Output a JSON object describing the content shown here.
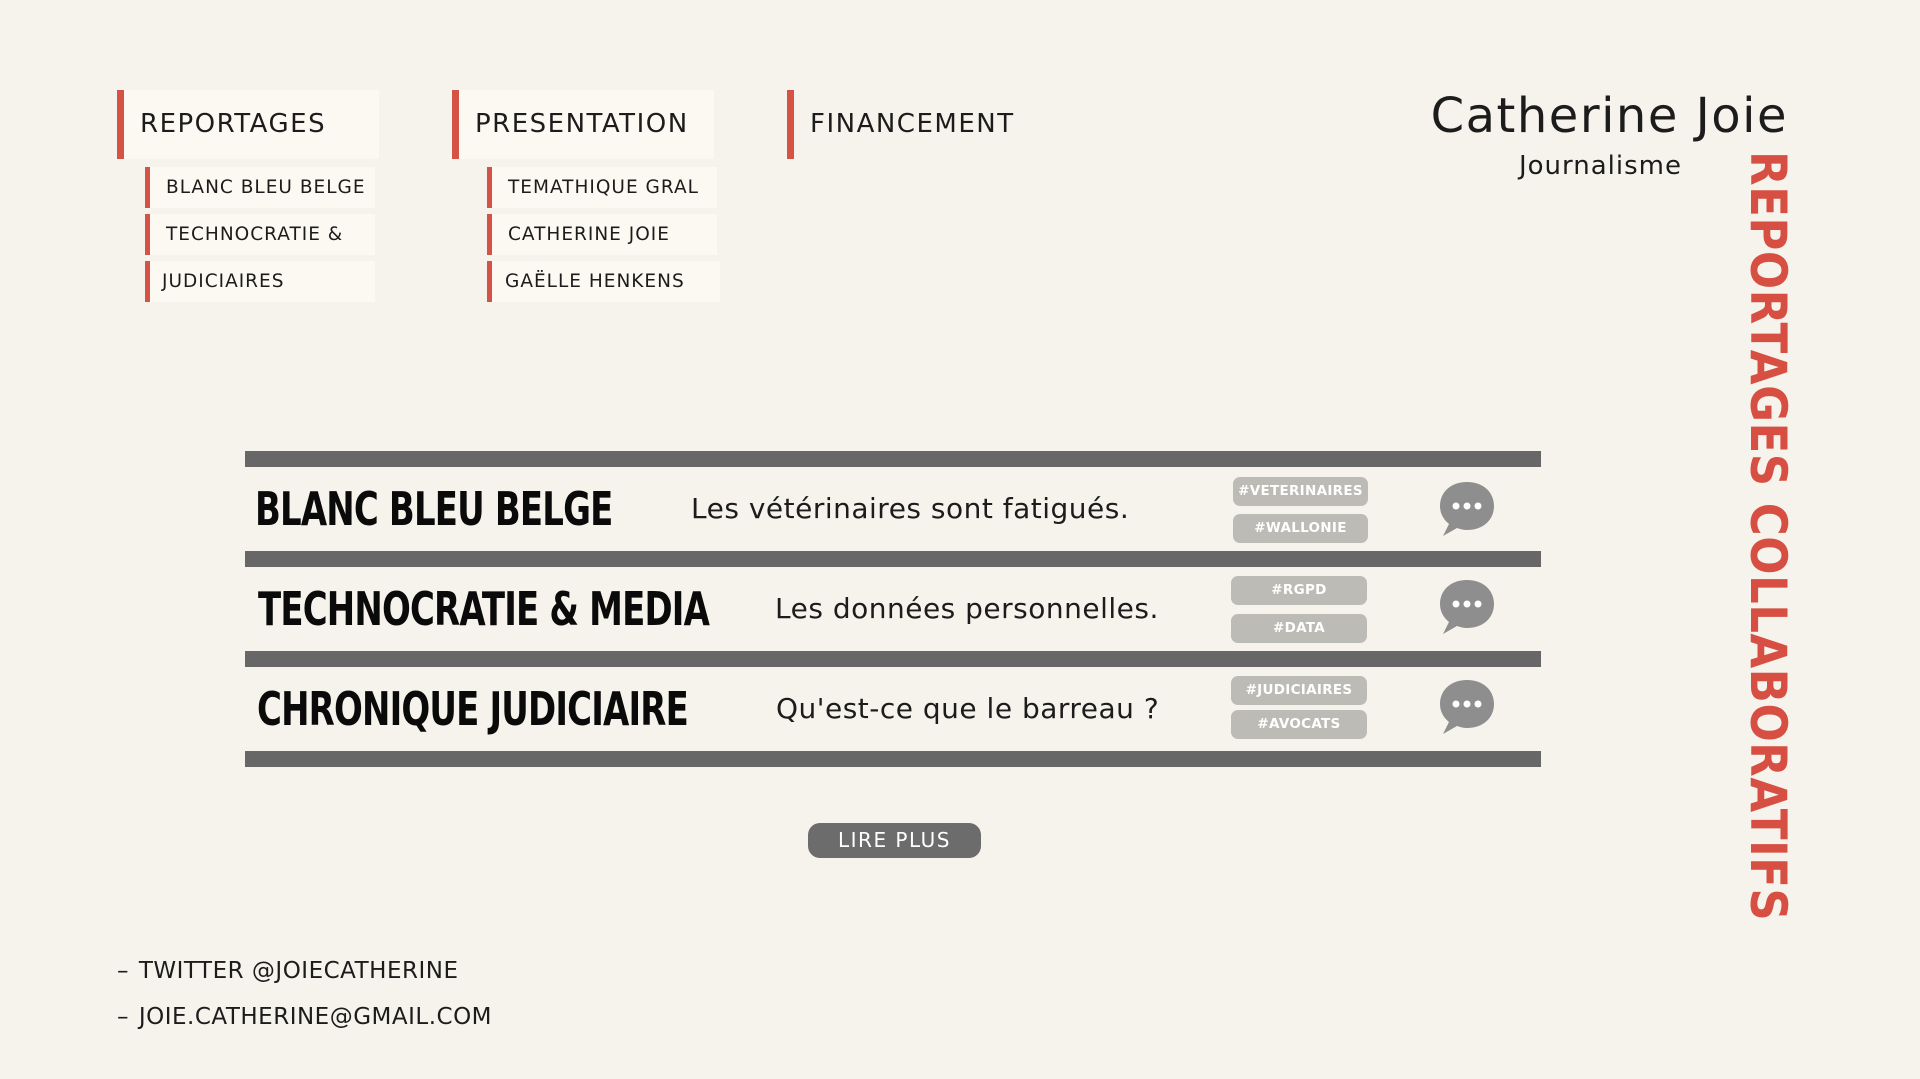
{
  "nav": {
    "reportages": {
      "label": "REPORTAGES",
      "items": [
        "BLANC BLEU BELGE",
        "TECHNOCRATIE &",
        "JUDICIAIRES"
      ]
    },
    "presentation": {
      "label": "PRESENTATION",
      "items": [
        "TEMATHIQUE GRAL",
        "CATHERINE JOIE",
        "GAËLLE HENKENS"
      ]
    },
    "financement": {
      "label": "FINANCEMENT"
    }
  },
  "brand": {
    "name": "Catherine Joie",
    "subtitle": "Journalisme"
  },
  "side_title": "REPORTAGES COLLABORATIFS",
  "articles": [
    {
      "title": "BLANC BLEU BELGE",
      "description": "Les vétérinaires sont fatigués.",
      "tags": [
        "#VETERINAIRES",
        "#WALLONIE"
      ]
    },
    {
      "title": "TECHNOCRATIE & MEDIA",
      "description": "Les données personnelles.",
      "tags": [
        "#RGPD",
        "#DATA"
      ]
    },
    {
      "title": "CHRONIQUE JUDICIAIRE",
      "description": "Qu'est-ce que le barreau ?",
      "tags": [
        "#JUDICIAIRES",
        "#AVOCATS"
      ]
    }
  ],
  "read_more": "LIRE PLUS",
  "contacts": {
    "dash": "–",
    "twitter": "TWITTER @JOIECATHERINE",
    "email": "JOIE.CATHERINE@GMAIL.COM"
  },
  "colors": {
    "accent": "#d45246",
    "band": "#676767",
    "tag": "#bdbbb5",
    "background": "#f5f3ec"
  },
  "icons": {
    "comment": "chat-bubble-icon"
  }
}
